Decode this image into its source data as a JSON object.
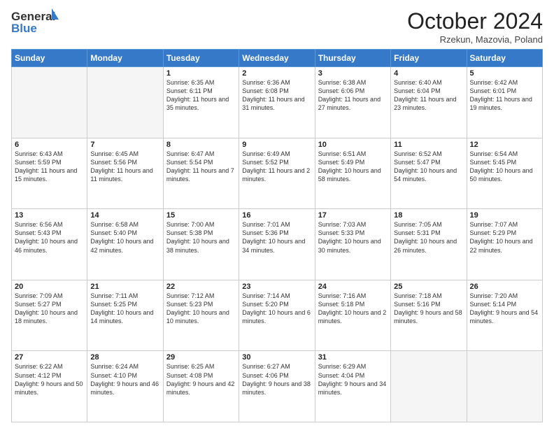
{
  "logo": {
    "line1": "General",
    "line2": "Blue"
  },
  "header": {
    "month": "October 2024",
    "location": "Rzekun, Mazovia, Poland"
  },
  "days_of_week": [
    "Sunday",
    "Monday",
    "Tuesday",
    "Wednesday",
    "Thursday",
    "Friday",
    "Saturday"
  ],
  "weeks": [
    [
      {
        "day": "",
        "info": ""
      },
      {
        "day": "",
        "info": ""
      },
      {
        "day": "1",
        "info": "Sunrise: 6:35 AM\nSunset: 6:11 PM\nDaylight: 11 hours and 35 minutes."
      },
      {
        "day": "2",
        "info": "Sunrise: 6:36 AM\nSunset: 6:08 PM\nDaylight: 11 hours and 31 minutes."
      },
      {
        "day": "3",
        "info": "Sunrise: 6:38 AM\nSunset: 6:06 PM\nDaylight: 11 hours and 27 minutes."
      },
      {
        "day": "4",
        "info": "Sunrise: 6:40 AM\nSunset: 6:04 PM\nDaylight: 11 hours and 23 minutes."
      },
      {
        "day": "5",
        "info": "Sunrise: 6:42 AM\nSunset: 6:01 PM\nDaylight: 11 hours and 19 minutes."
      }
    ],
    [
      {
        "day": "6",
        "info": "Sunrise: 6:43 AM\nSunset: 5:59 PM\nDaylight: 11 hours and 15 minutes."
      },
      {
        "day": "7",
        "info": "Sunrise: 6:45 AM\nSunset: 5:56 PM\nDaylight: 11 hours and 11 minutes."
      },
      {
        "day": "8",
        "info": "Sunrise: 6:47 AM\nSunset: 5:54 PM\nDaylight: 11 hours and 7 minutes."
      },
      {
        "day": "9",
        "info": "Sunrise: 6:49 AM\nSunset: 5:52 PM\nDaylight: 11 hours and 2 minutes."
      },
      {
        "day": "10",
        "info": "Sunrise: 6:51 AM\nSunset: 5:49 PM\nDaylight: 10 hours and 58 minutes."
      },
      {
        "day": "11",
        "info": "Sunrise: 6:52 AM\nSunset: 5:47 PM\nDaylight: 10 hours and 54 minutes."
      },
      {
        "day": "12",
        "info": "Sunrise: 6:54 AM\nSunset: 5:45 PM\nDaylight: 10 hours and 50 minutes."
      }
    ],
    [
      {
        "day": "13",
        "info": "Sunrise: 6:56 AM\nSunset: 5:43 PM\nDaylight: 10 hours and 46 minutes."
      },
      {
        "day": "14",
        "info": "Sunrise: 6:58 AM\nSunset: 5:40 PM\nDaylight: 10 hours and 42 minutes."
      },
      {
        "day": "15",
        "info": "Sunrise: 7:00 AM\nSunset: 5:38 PM\nDaylight: 10 hours and 38 minutes."
      },
      {
        "day": "16",
        "info": "Sunrise: 7:01 AM\nSunset: 5:36 PM\nDaylight: 10 hours and 34 minutes."
      },
      {
        "day": "17",
        "info": "Sunrise: 7:03 AM\nSunset: 5:33 PM\nDaylight: 10 hours and 30 minutes."
      },
      {
        "day": "18",
        "info": "Sunrise: 7:05 AM\nSunset: 5:31 PM\nDaylight: 10 hours and 26 minutes."
      },
      {
        "day": "19",
        "info": "Sunrise: 7:07 AM\nSunset: 5:29 PM\nDaylight: 10 hours and 22 minutes."
      }
    ],
    [
      {
        "day": "20",
        "info": "Sunrise: 7:09 AM\nSunset: 5:27 PM\nDaylight: 10 hours and 18 minutes."
      },
      {
        "day": "21",
        "info": "Sunrise: 7:11 AM\nSunset: 5:25 PM\nDaylight: 10 hours and 14 minutes."
      },
      {
        "day": "22",
        "info": "Sunrise: 7:12 AM\nSunset: 5:23 PM\nDaylight: 10 hours and 10 minutes."
      },
      {
        "day": "23",
        "info": "Sunrise: 7:14 AM\nSunset: 5:20 PM\nDaylight: 10 hours and 6 minutes."
      },
      {
        "day": "24",
        "info": "Sunrise: 7:16 AM\nSunset: 5:18 PM\nDaylight: 10 hours and 2 minutes."
      },
      {
        "day": "25",
        "info": "Sunrise: 7:18 AM\nSunset: 5:16 PM\nDaylight: 9 hours and 58 minutes."
      },
      {
        "day": "26",
        "info": "Sunrise: 7:20 AM\nSunset: 5:14 PM\nDaylight: 9 hours and 54 minutes."
      }
    ],
    [
      {
        "day": "27",
        "info": "Sunrise: 6:22 AM\nSunset: 4:12 PM\nDaylight: 9 hours and 50 minutes."
      },
      {
        "day": "28",
        "info": "Sunrise: 6:24 AM\nSunset: 4:10 PM\nDaylight: 9 hours and 46 minutes."
      },
      {
        "day": "29",
        "info": "Sunrise: 6:25 AM\nSunset: 4:08 PM\nDaylight: 9 hours and 42 minutes."
      },
      {
        "day": "30",
        "info": "Sunrise: 6:27 AM\nSunset: 4:06 PM\nDaylight: 9 hours and 38 minutes."
      },
      {
        "day": "31",
        "info": "Sunrise: 6:29 AM\nSunset: 4:04 PM\nDaylight: 9 hours and 34 minutes."
      },
      {
        "day": "",
        "info": ""
      },
      {
        "day": "",
        "info": ""
      }
    ]
  ]
}
